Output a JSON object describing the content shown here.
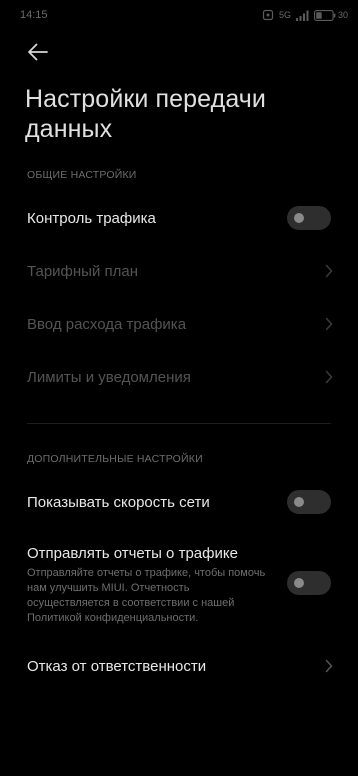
{
  "status_bar": {
    "time": "14:15",
    "network": "5G",
    "battery": "30"
  },
  "header": {
    "title": "Настройки передачи данных"
  },
  "sections": {
    "general": {
      "header": "ОБЩИЕ НАСТРОЙКИ",
      "traffic_control": {
        "label": "Контроль трафика",
        "enabled": false
      },
      "tariff_plan": {
        "label": "Тарифный план"
      },
      "traffic_input": {
        "label": "Ввод расхода трафика"
      },
      "limits": {
        "label": "Лимиты и уведомления"
      }
    },
    "additional": {
      "header": "ДОПОЛНИТЕЛЬНЫЕ НАСТРОЙКИ",
      "show_speed": {
        "label": "Показывать скорость сети",
        "enabled": false
      },
      "send_reports": {
        "label": "Отправлять отчеты о трафике",
        "description": "Отправляйте отчеты о трафике, чтобы помочь нам улучшить MIUI. Отчетность осуществляется в соответствии с нашей Политикой конфиденциальности.",
        "enabled": false
      },
      "disclaimer": {
        "label": "Отказ от ответственности"
      }
    }
  }
}
